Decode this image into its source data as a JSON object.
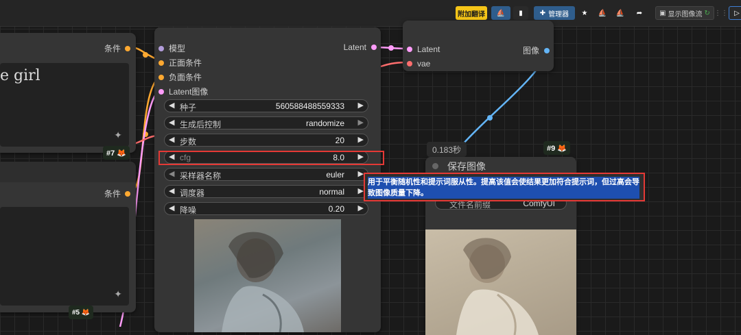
{
  "topbar": {
    "translate_label": "附加翻译",
    "manager_label": "管理器",
    "show_image_stream_label": "显示图像流"
  },
  "left_nodes": {
    "top_output_label": "条件",
    "top_text": "e girl",
    "top_badge": "#7 🦊",
    "bottom_output_label": "条件",
    "bottom_badge": "#5 🦊"
  },
  "ksampler": {
    "inputs": [
      "模型",
      "正面条件",
      "负面条件",
      "Latent图像"
    ],
    "output_label": "Latent",
    "widgets": [
      {
        "label": "种子",
        "value": "560588488559333"
      },
      {
        "label": "生成后控制",
        "value": "randomize"
      },
      {
        "label": "步数",
        "value": "20"
      },
      {
        "label": "cfg",
        "value": "8.0"
      },
      {
        "label": "采样器名称",
        "value": "euler"
      },
      {
        "label": "调度器",
        "value": "normal"
      },
      {
        "label": "降噪",
        "value": "0.20"
      }
    ]
  },
  "vae_decode": {
    "inputs": [
      "Latent",
      "vae"
    ],
    "output_label": "图像"
  },
  "save_image": {
    "time": "0.183秒",
    "badge": "#9 🦊",
    "title": "保存图像",
    "filename_prefix_label": "文件名前缀",
    "filename_prefix_value": "ComfyUI"
  },
  "tooltip": {
    "text": "用于平衡随机性和提示词服从性。提高该值会使结果更加符合提示词，但过高会导致图像质量下降。"
  },
  "colors": {
    "model": "#b39ddb",
    "conditioning": "#ffa931",
    "latent": "#ff9cf9",
    "vae": "#ff6e6e",
    "image": "#64b5f6",
    "highlight": "#e53935",
    "tooltip_bg": "#1e4fb0"
  }
}
